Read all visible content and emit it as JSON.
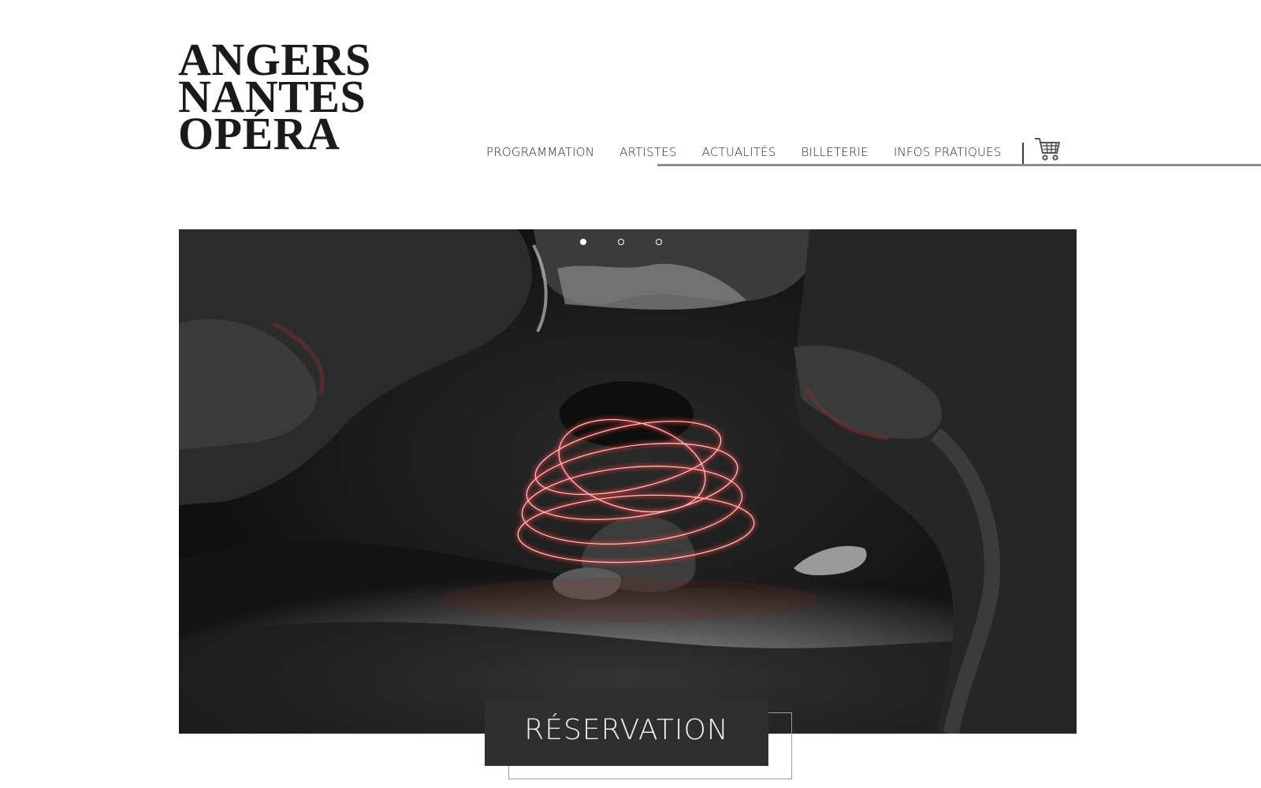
{
  "logo": {
    "line1": "ANGERS",
    "line2": "NANTES",
    "line3": "OPÉRA"
  },
  "nav": {
    "items": [
      {
        "label": "PROGRAMMATION"
      },
      {
        "label": "ARTISTES"
      },
      {
        "label": "ACTUALITÉS"
      },
      {
        "label": "BILLETERIE"
      },
      {
        "label": "INFOS PRATIQUES"
      }
    ],
    "cart_icon": "shopping-cart-icon"
  },
  "slideshow": {
    "slide_count": 3,
    "active_index": 0,
    "image_subject": "light painting in a cave"
  },
  "cta": {
    "label": "RÉSERVATION"
  },
  "colors": {
    "text": "#1a1a1a",
    "cta_background": "#2f2f2f",
    "light_trail": "#ff3b3b"
  }
}
